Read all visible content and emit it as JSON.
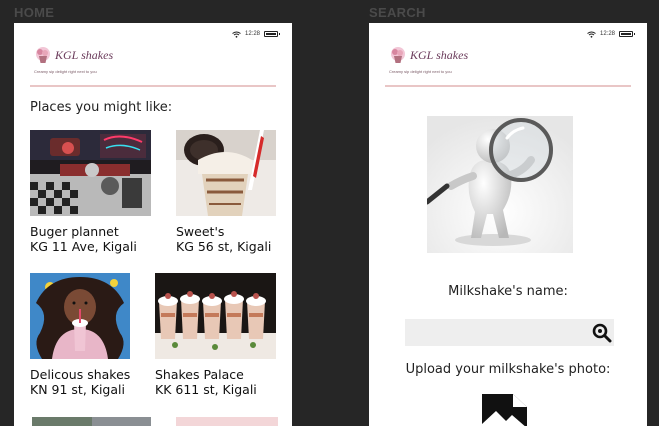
{
  "screens": {
    "home": {
      "label": "HOME",
      "status": {
        "time": "12:28"
      },
      "brand": {
        "name": "KGL shakes",
        "tagline": "Creamy sip delight right next to you"
      },
      "heading": "Places you might like:",
      "places": [
        {
          "name": "Buger plannet",
          "address": "KG 11 Ave, Kigali"
        },
        {
          "name": "Sweet's",
          "address": "KG 56 st, Kigali"
        },
        {
          "name": "Delicous shakes",
          "address": "KN 91 st, Kigali"
        },
        {
          "name": "Shakes Palace",
          "address": "KK 611 st, Kigali"
        }
      ]
    },
    "search": {
      "label": "SEARCH",
      "status": {
        "time": "12:28"
      },
      "brand": {
        "name": "KGL shakes",
        "tagline": "Creamy sip delight right next to you"
      },
      "name_label": "Milkshake's name:",
      "name_value": "",
      "upload_label": "Upload your milkshake's photo:"
    }
  }
}
